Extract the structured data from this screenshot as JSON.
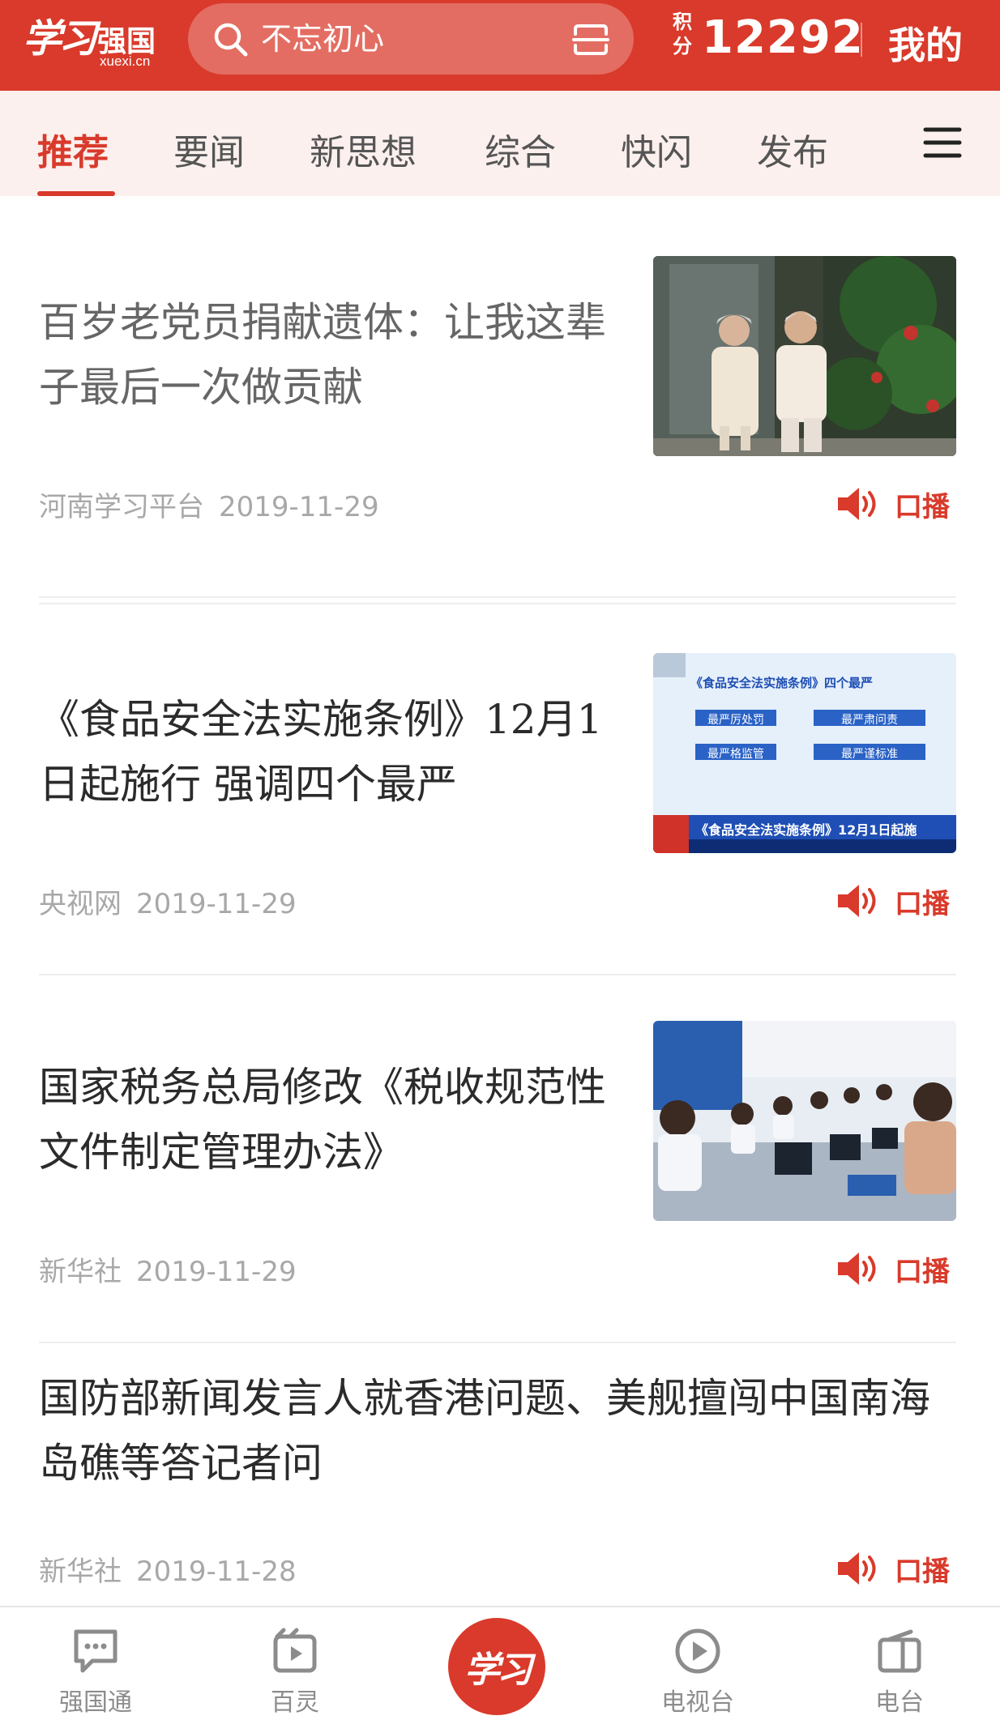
{
  "header": {
    "logo_script": "学习",
    "logo_brand": "强国",
    "logo_domain": "xuexi.cn",
    "search_placeholder": "不忘初心",
    "points_label": "积分",
    "points_value": "12292",
    "mine_label": "我的"
  },
  "tabs": [
    {
      "label": "推荐",
      "active": true
    },
    {
      "label": "要闻",
      "active": false
    },
    {
      "label": "新思想",
      "active": false
    },
    {
      "label": "综合",
      "active": false
    },
    {
      "label": "快闪",
      "active": false
    },
    {
      "label": "发布",
      "active": false
    }
  ],
  "articles": [
    {
      "title": "百岁老党员捐献遗体：让我这辈子最后一次做贡献",
      "source": "河南学习平台",
      "date": "2019-11-29",
      "broadcast_label": "口播",
      "has_thumbnail": true,
      "thumbnail_icon": "elderly-couple-photo"
    },
    {
      "title": "《食品安全法实施条例》12月1日起施行 强调四个最严",
      "source": "央视网",
      "date": "2019-11-29",
      "broadcast_label": "口播",
      "has_thumbnail": true,
      "thumbnail_icon": "tv-news-graphic",
      "thumbnail_text": {
        "heading": "《食品安全法实施条例》四个最严",
        "boxes": [
          "最严厉处罚",
          "最严肃问责",
          "最严格监管",
          "最严谨标准"
        ],
        "ticker": "《食品安全法实施条例》12月1日起施"
      }
    },
    {
      "title": "国家税务总局修改《税收规范性文件制定管理办法》",
      "source": "新华社",
      "date": "2019-11-29",
      "broadcast_label": "口播",
      "has_thumbnail": true,
      "thumbnail_icon": "tax-service-hall-photo"
    },
    {
      "title": "国防部新闻发言人就香港问题、美舰擅闯中国南海岛礁等答记者问",
      "source": "新华社",
      "date": "2019-11-28",
      "broadcast_label": "口播",
      "has_thumbnail": false
    }
  ],
  "bottom_nav": [
    {
      "label": "强国通",
      "icon": "chat-icon"
    },
    {
      "label": "百灵",
      "icon": "short-video-icon"
    },
    {
      "label": "学习",
      "icon": "study-center-icon"
    },
    {
      "label": "电视台",
      "icon": "play-icon"
    },
    {
      "label": "电台",
      "icon": "radio-icon"
    }
  ],
  "colors": {
    "brand_red": "#d93a2b",
    "tab_bar_bg": "#fbf0ee",
    "meta_gray": "#a8a8a8"
  }
}
